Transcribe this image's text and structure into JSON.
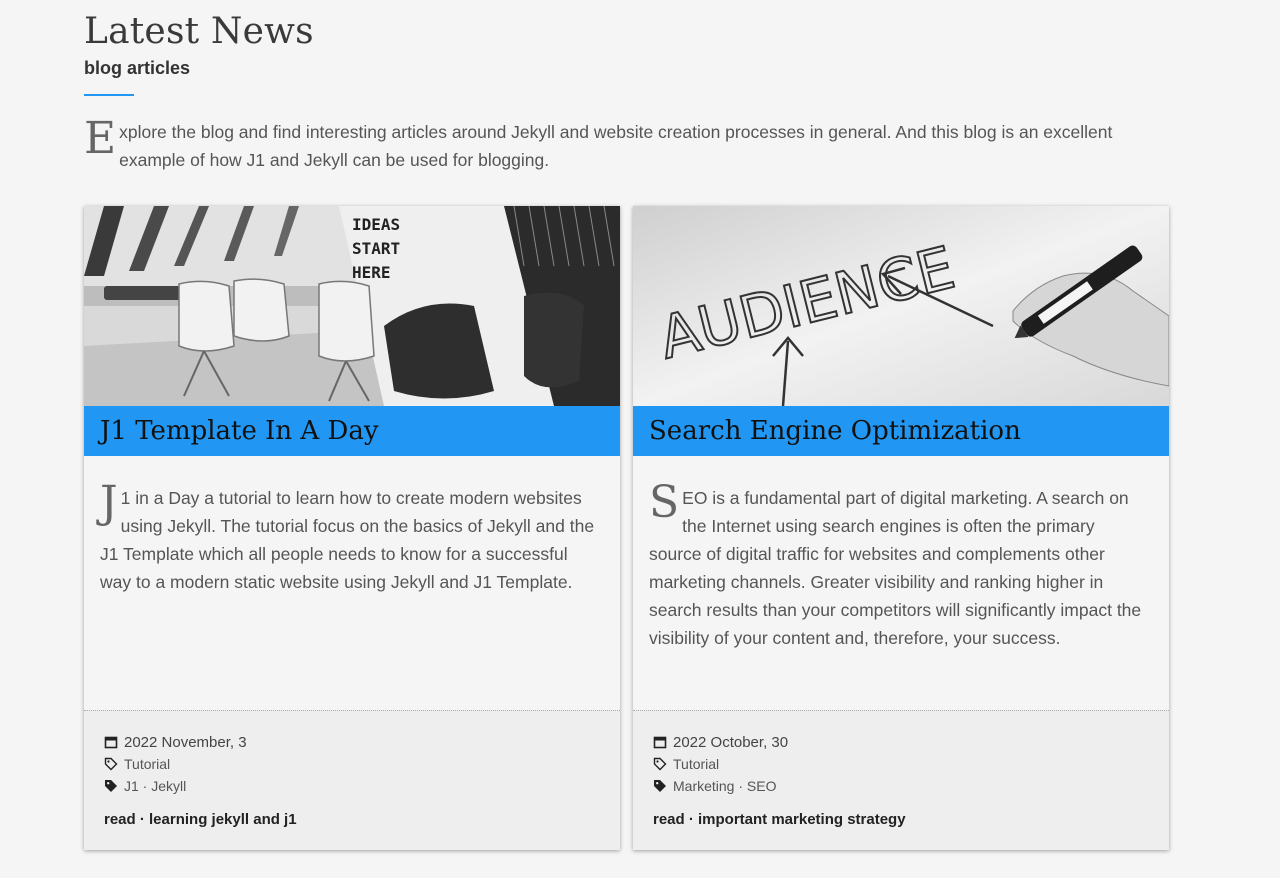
{
  "header": {
    "title": "Latest News",
    "subtitle": "blog articles"
  },
  "intro": {
    "dropcap": "E",
    "text": "xplore the blog and find interesting articles around Jekyll and website creation processes in general. And this blog is an excellent example of how J1 and Jekyll can be used for blogging."
  },
  "colors": {
    "accent": "#2196f3",
    "background": "#f5f5f5",
    "footer": "#eeeeee"
  },
  "cards": [
    {
      "title": "J1 Template In A Day",
      "dropcap": "J",
      "body": "1 in a Day a tutorial to learn how to create modern websites using Jekyll. The tutorial focus on the basics of Jekyll and the J1 Template which all people needs to know for a successful way to a modern static website using Jekyll and J1 Template.",
      "date": "2022 November, 3",
      "category": "Tutorial",
      "tags": "J1 · Jekyll",
      "read_link": "read · learning jekyll and j1",
      "image_icon": "office-chairs-image",
      "image_text": [
        "IDEAS",
        "START",
        "HERE"
      ]
    },
    {
      "title": "Search Engine Optimization",
      "dropcap": "S",
      "body": "EO is a fundamental part of digital marketing. A search on the Internet using search engines is often the primary source of digital traffic for websites and complements other marketing channels. Greater visibility and ranking higher in search results than your competitors will significantly impact the visibility of your content and, therefore, your success.",
      "date": "2022 October, 30",
      "category": "Tutorial",
      "tags": "Marketing · SEO",
      "read_link": "read · important marketing strategy",
      "image_icon": "audience-whiteboard-image",
      "image_text": "AUDIENCE"
    }
  ]
}
